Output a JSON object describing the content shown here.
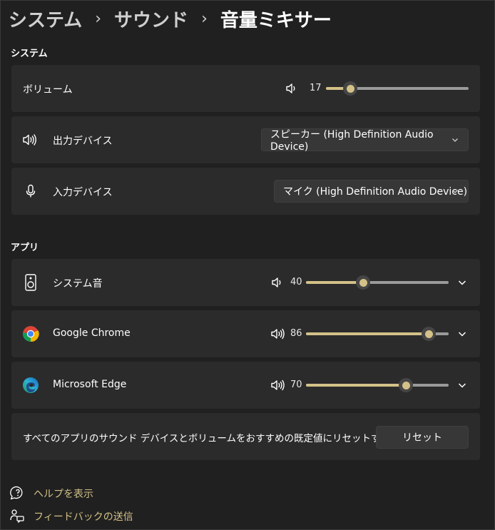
{
  "breadcrumb": {
    "items": [
      "システム",
      "サウンド",
      "音量ミキサー"
    ],
    "separator": "›"
  },
  "sections": {
    "system_title": "システム",
    "apps_title": "アプリ"
  },
  "system": {
    "volume": {
      "label": "ボリューム",
      "value": "17",
      "level_percent": 17
    },
    "output": {
      "label": "出力デバイス",
      "selected": "スピーカー (High Definition Audio Device)"
    },
    "input": {
      "label": "入力デバイス",
      "selected": "マイク (High Definition Audio Device)"
    }
  },
  "apps": [
    {
      "name": "システム音",
      "icon": "speaker-device-icon",
      "value": "40",
      "level_percent": 40
    },
    {
      "name": "Google Chrome",
      "icon": "chrome-icon",
      "value": "86",
      "level_percent": 86
    },
    {
      "name": "Microsoft Edge",
      "icon": "edge-icon",
      "value": "70",
      "level_percent": 70
    }
  ],
  "reset": {
    "description": "すべてのアプリのサウンド デバイスとボリュームをおすすめの既定値にリセットする",
    "button_label": "リセット"
  },
  "footer": {
    "help": "ヘルプを表示",
    "feedback": "フィードバックの送信"
  },
  "colors": {
    "background": "#202020",
    "card": "#2b2b2b",
    "accent": "#d3c188"
  }
}
